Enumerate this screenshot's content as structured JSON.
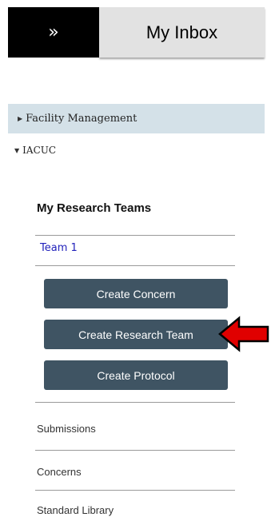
{
  "header": {
    "expand_icon_glyph": "»",
    "title": "My Inbox"
  },
  "nav": {
    "facility_label": "Facility Management",
    "iacuc_label": "IACUC"
  },
  "research_teams": {
    "heading": "My Research Teams",
    "teams": [
      "Team 1"
    ]
  },
  "actions": {
    "create_concern": "Create Concern",
    "create_research_team": "Create Research Team",
    "create_protocol": "Create Protocol"
  },
  "links": {
    "submissions": "Submissions",
    "concerns": "Concerns",
    "standard_library": "Standard Library"
  },
  "colors": {
    "button_bg": "#3f5463",
    "nav_highlight": "#d4e1e8",
    "team_link": "#2222bb",
    "annotation_arrow": "#e00000"
  }
}
